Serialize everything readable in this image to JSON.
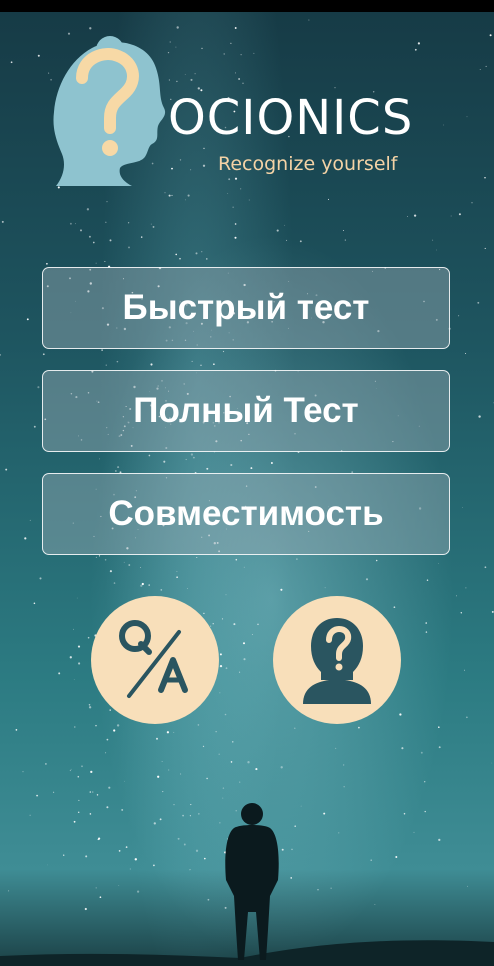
{
  "logo": {
    "title": "OCIONICS",
    "tagline": "Recognize yourself",
    "icon": "head-question-icon"
  },
  "menu": {
    "buttons": [
      {
        "label": "Быстрый тест"
      },
      {
        "label": "Полный Тест"
      },
      {
        "label": "Совместимость"
      }
    ]
  },
  "round_buttons": {
    "qa": {
      "icon": "qa-icon"
    },
    "profile": {
      "icon": "person-question-icon"
    }
  },
  "colors": {
    "accent": "#f8dfba",
    "icon_dark": "#2a5560",
    "tagline": "#f4d3a6"
  }
}
